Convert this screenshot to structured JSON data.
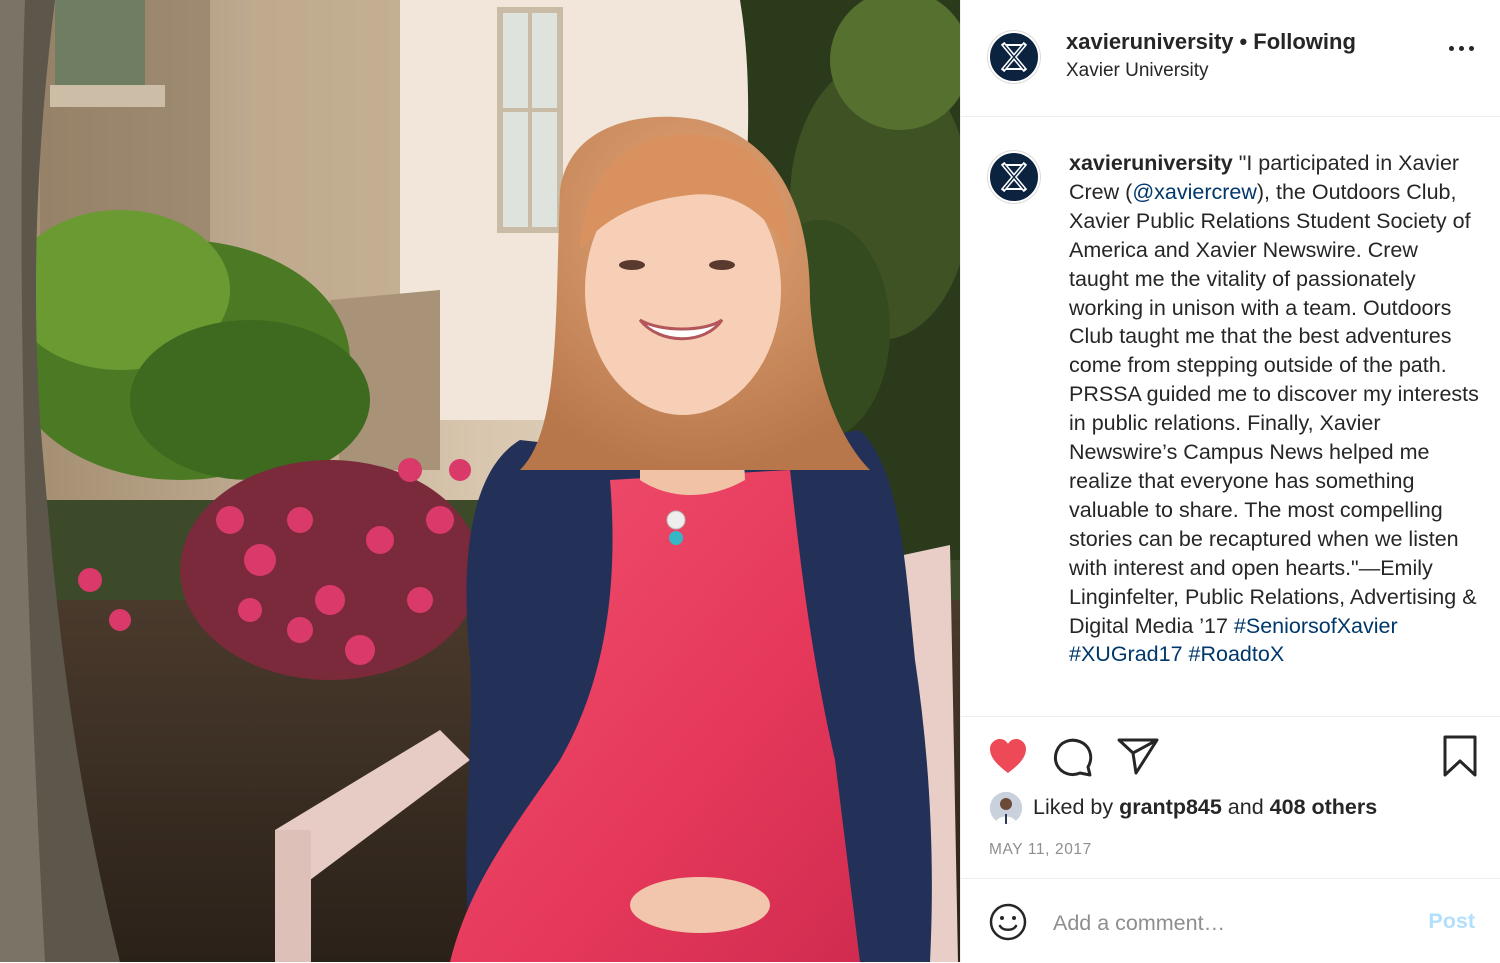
{
  "post": {
    "username": "xavieruniversity",
    "follow_status": "Following",
    "separator": "•",
    "location": "Xavier University",
    "more_icon": "more-horizontal-icon"
  },
  "caption": {
    "username": "xavieruniversity",
    "text_before_mention": " \"I participated in Xavier Crew (",
    "mention": "@xaviercrew",
    "text_after_mention": "), the Outdoors Club, Xavier Public Relations Student Society of America and Xavier Newswire. Crew taught me the vitality of passionately working in unison with a team. Outdoors Club taught me that the best adventures come from stepping outside of the path. PRSSA guided me to discover my interests in public relations. Finally, Xavier Newswire’s Campus News helped me realize that everyone has something valuable to share. The most compelling stories can be recaptured when we listen with interest and open hearts.\"—Emily Linginfelter, Public Relations, Advertising & Digital Media ’17 ",
    "hashtag_1": "#SeniorsofXavier",
    "hashtag_2": "#XUGrad17",
    "hashtag_3": "#RoadtoX"
  },
  "actions": {
    "like_icon": "heart-filled-icon",
    "comment_icon": "comment-icon",
    "share_icon": "send-icon",
    "save_icon": "bookmark-icon",
    "like_color": "#ed4956"
  },
  "likes": {
    "prefix": "Liked by ",
    "user": "grantp845",
    "middle": " and ",
    "others": "408 others"
  },
  "date": "MAY 11, 2017",
  "comment": {
    "placeholder": "Add a comment…",
    "post_label": "Post",
    "emoji_icon": "smile-icon"
  },
  "colors": {
    "brand_navy": "#0c2340",
    "link": "#00376b",
    "post_disabled": "#b2dffc"
  }
}
